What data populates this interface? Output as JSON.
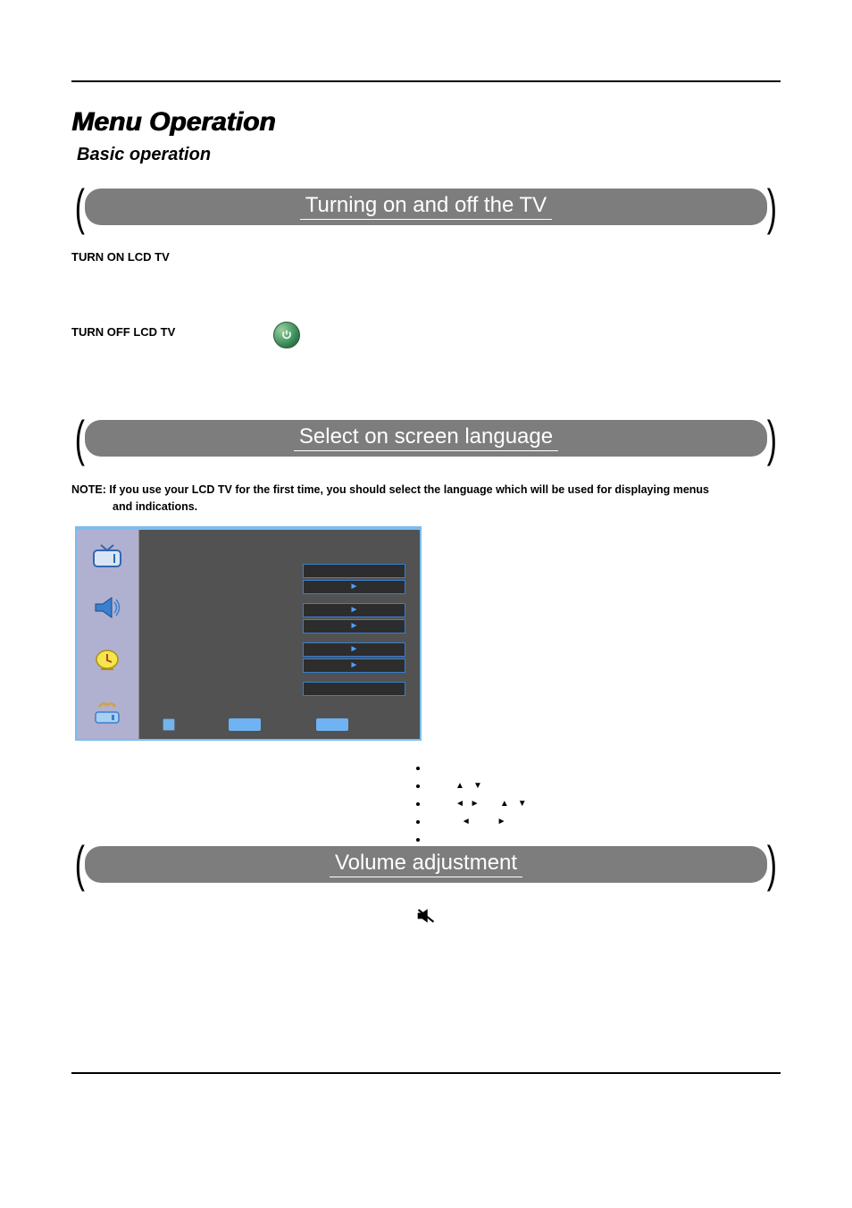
{
  "page_title": "Menu Operation",
  "subtitle": "Basic operation",
  "sections": {
    "power": {
      "heading": "Turning on  and off the TV",
      "turn_on_label": "TURN ON LCD TV",
      "turn_off_label": "TURN OFF LCD TV",
      "power_icon_name": "power-icon"
    },
    "language": {
      "heading": "Select on screen language",
      "note_prefix": "NOTE:",
      "note_body": "If you use your LCD TV for the first time, you should select the language which will be used for displaying menus",
      "note_line2": "and indications.",
      "menu": {
        "sidebar_icons": [
          "tv-icon",
          "speaker-icon",
          "clock-icon",
          "eject-icon"
        ],
        "item_arrow": "►"
      },
      "instructions": {
        "b1": "",
        "b2_sym_up": "▲",
        "b2_sym_down": "▼",
        "b3_sym_left": "◄",
        "b3_sym_right": "►",
        "b3_sym_up": "▲",
        "b3_sym_down": "▼",
        "b4_sym_left": "◄",
        "b4_sym_right": "►"
      }
    },
    "volume": {
      "heading": "Volume adjustment",
      "mute_icon_name": "mute-icon"
    }
  }
}
